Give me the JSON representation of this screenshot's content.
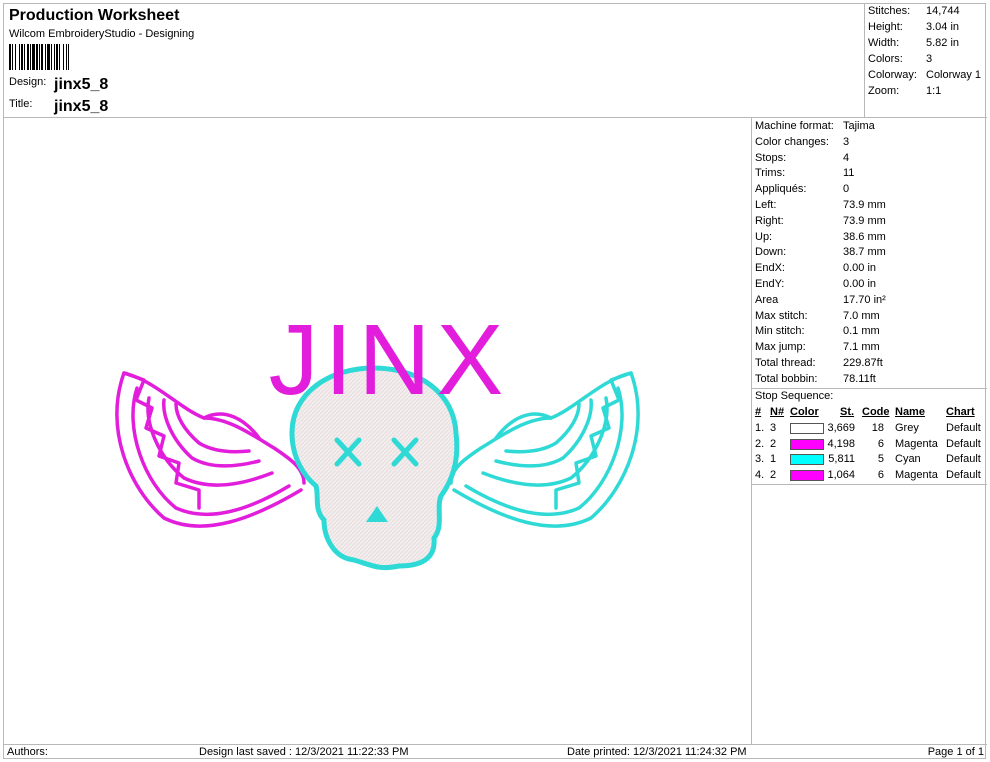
{
  "header": {
    "title": "Production Worksheet",
    "subtitle": "Wilcom EmbroideryStudio - Designing",
    "design_label": "Design:",
    "design_value": "jinx5_8",
    "title_label": "Title:",
    "title_value": "jinx5_8"
  },
  "stats": [
    {
      "key": "Stitches:",
      "value": "14,744"
    },
    {
      "key": "Height:",
      "value": "3.04 in"
    },
    {
      "key": "Width:",
      "value": "5.82 in"
    },
    {
      "key": "Colors:",
      "value": "3"
    },
    {
      "key": "Colorway:",
      "value": "Colorway 1"
    },
    {
      "key": "Zoom:",
      "value": "1:1"
    }
  ],
  "design": {
    "text": "JINX",
    "colors": {
      "magenta": "#e21ddb",
      "cyan": "#2fdad6",
      "grey": "#f3eded"
    }
  },
  "info": [
    {
      "key": "Machine format:",
      "value": "Tajima"
    },
    {
      "key": "Color changes:",
      "value": "3"
    },
    {
      "key": "Stops:",
      "value": "4"
    },
    {
      "key": "Trims:",
      "value": "11"
    },
    {
      "key": "Appliqués:",
      "value": "0"
    },
    {
      "key": "Left:",
      "value": "73.9 mm"
    },
    {
      "key": "Right:",
      "value": "73.9 mm"
    },
    {
      "key": "Up:",
      "value": "38.6 mm"
    },
    {
      "key": "Down:",
      "value": "38.7 mm"
    },
    {
      "key": "EndX:",
      "value": "0.00 in"
    },
    {
      "key": "EndY:",
      "value": "0.00 in"
    },
    {
      "key": "Area",
      "value": " 17.70 in²"
    },
    {
      "key": "Max stitch:",
      "value": "7.0 mm"
    },
    {
      "key": "Min stitch:",
      "value": "0.1 mm"
    },
    {
      "key": "Max jump:",
      "value": "7.1 mm"
    },
    {
      "key": "Total thread:",
      "value": "229.87ft"
    },
    {
      "key": "Total bobbin:",
      "value": "78.11ft"
    }
  ],
  "stop_sequence": {
    "title": "Stop Sequence:",
    "headers": {
      "num": "#",
      "n": "N#",
      "color": "Color",
      "st": "St.",
      "code": "Code",
      "name": "Name",
      "chart": "Chart"
    },
    "rows": [
      {
        "num": "1.",
        "n": "3",
        "swatch": "#ffffff",
        "st": "3,669",
        "code": "18",
        "name": "Grey",
        "chart": "Default"
      },
      {
        "num": "2.",
        "n": "2",
        "swatch": "#ff00ff",
        "st": "4,198",
        "code": "6",
        "name": "Magenta",
        "chart": "Default"
      },
      {
        "num": "3.",
        "n": "1",
        "swatch": "#00ffff",
        "st": "5,811",
        "code": "5",
        "name": "Cyan",
        "chart": "Default"
      },
      {
        "num": "4.",
        "n": "2",
        "swatch": "#ff00ff",
        "st": "1,064",
        "code": "6",
        "name": "Magenta",
        "chart": "Default"
      }
    ]
  },
  "footer": {
    "authors": "Authors:",
    "saved": "Design last saved : 12/3/2021 11:22:33 PM",
    "printed": "Date printed: 12/3/2021 11:24:32 PM",
    "page": "Page 1 of 1"
  }
}
